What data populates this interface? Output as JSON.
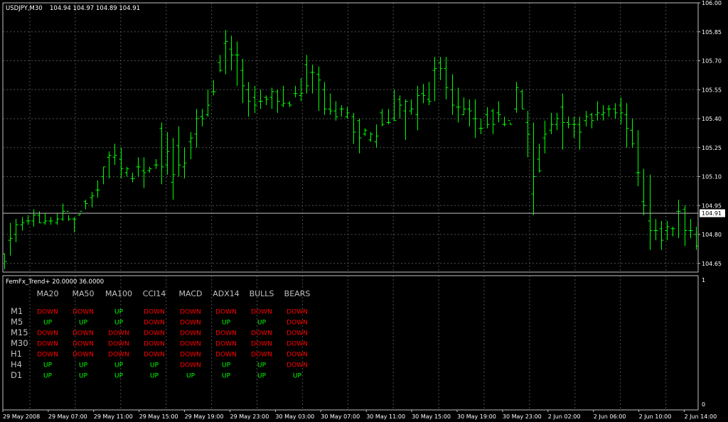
{
  "colors": {
    "background": "#000000",
    "grid": "#4a5050",
    "frame": "#c0c0c0",
    "bar": "#00ff00",
    "text": "#ffffff",
    "label_text": "#c0c0c0",
    "price_tag_bg": "#ffffff",
    "price_tag_text": "#000000",
    "up": "#00ff00",
    "down": "#ff0000"
  },
  "price_window": {
    "symbol": "USDJPY,M30",
    "ohlc": "104.94 104.97 104.89 104.91",
    "current_price_label": "104.91"
  },
  "indicator_window": {
    "name": "FemFx_Trend+ 20.0000 36.0000",
    "scale_top": "1",
    "scale_bottom": "0",
    "columns": [
      "MA20",
      "MA50",
      "MA100",
      "CCI14",
      "MACD",
      "ADX14",
      "BULLS",
      "BEARS"
    ],
    "rows": [
      {
        "timeframe": "M1",
        "signals": [
          "DOWN",
          "DOWN",
          "UP",
          "DOWN",
          "DOWN",
          "DOWN",
          "DOWN",
          "DOWN"
        ]
      },
      {
        "timeframe": "M5",
        "signals": [
          "UP",
          "UP",
          "UP",
          "DOWN",
          "DOWN",
          "UP",
          "UP",
          "DOWN"
        ]
      },
      {
        "timeframe": "M15",
        "signals": [
          "DOWN",
          "DOWN",
          "DOWN",
          "DOWN",
          "DOWN",
          "DOWN",
          "DOWN",
          "DOWN"
        ]
      },
      {
        "timeframe": "M30",
        "signals": [
          "DOWN",
          "DOWN",
          "DOWN",
          "DOWN",
          "DOWN",
          "DOWN",
          "DOWN",
          "DOWN"
        ]
      },
      {
        "timeframe": "H1",
        "signals": [
          "DOWN",
          "DOWN",
          "DOWN",
          "DOWN",
          "DOWN",
          "DOWN",
          "DOWN",
          "DOWN"
        ]
      },
      {
        "timeframe": "H4",
        "signals": [
          "UP",
          "UP",
          "UP",
          "UP",
          "DOWN",
          "UP",
          "UP",
          "DOWN"
        ]
      },
      {
        "timeframe": "D1",
        "signals": [
          "UP",
          "UP",
          "UP",
          "UP",
          "UP",
          "UP",
          "UP",
          "UP"
        ]
      }
    ]
  },
  "chart_data": {
    "type": "ohlc-bar",
    "title": "USDJPY,M30",
    "ylim": [
      104.6,
      106.0
    ],
    "y_ticks": [
      "106.00",
      "105.85",
      "105.70",
      "105.55",
      "105.40",
      "105.25",
      "105.10",
      "104.95",
      "104.80",
      "104.65"
    ],
    "x_ticks": [
      "29 May 2008",
      "29 May 07:00",
      "29 May 11:00",
      "29 May 15:00",
      "29 May 19:00",
      "29 May 23:00",
      "30 May 03:00",
      "30 May 07:00",
      "30 May 11:00",
      "30 May 15:00",
      "30 May 19:00",
      "30 May 23:00",
      "2 Jun 02:00",
      "2 Jun 06:00",
      "2 Jun 10:00",
      "2 Jun 14:00"
    ],
    "current_price": 104.91,
    "bars_high": [
      104.7,
      104.86,
      104.88,
      104.89,
      104.9,
      104.93,
      104.92,
      104.91,
      104.89,
      104.91,
      104.96,
      104.87,
      104.89,
      104.91,
      104.98,
      105.02,
      105.08,
      105.15,
      105.23,
      105.27,
      105.25,
      105.15,
      105.12,
      105.2,
      105.2,
      105.15,
      105.19,
      105.38,
      105.33,
      105.3,
      105.36,
      105.25,
      105.33,
      105.45,
      105.45,
      105.55,
      105.6,
      105.73,
      105.86,
      105.83,
      105.8,
      105.71,
      105.59,
      105.57,
      105.55,
      105.52,
      105.56,
      105.55,
      105.57,
      105.49,
      105.57,
      105.61,
      105.73,
      105.68,
      105.67,
      105.59,
      105.53,
      105.49,
      105.47,
      105.46,
      105.43,
      105.4,
      105.35,
      105.33,
      105.37,
      105.45,
      105.45,
      105.55,
      105.52,
      105.5,
      105.5,
      105.57,
      105.58,
      105.59,
      105.72,
      105.72,
      105.72,
      105.63,
      105.56,
      105.51,
      105.5,
      105.5,
      105.4,
      105.46,
      105.45,
      105.49,
      105.41,
      105.38,
      105.59,
      105.55,
      105.44,
      105.38,
      105.27,
      105.39,
      105.43,
      105.43,
      105.53,
      105.41,
      105.41,
      105.41,
      105.44,
      105.43,
      105.49,
      105.47,
      105.47,
      105.48,
      105.51,
      105.48,
      105.4,
      105.34,
      105.14,
      105.11,
      104.88,
      104.87,
      104.87,
      104.84,
      104.98,
      104.95,
      104.88,
      104.84
    ],
    "bars_low": [
      104.62,
      104.69,
      104.76,
      104.82,
      104.85,
      104.84,
      104.86,
      104.85,
      104.85,
      104.85,
      104.87,
      104.9,
      104.81,
      104.9,
      104.93,
      104.94,
      104.99,
      105.06,
      105.09,
      105.16,
      105.09,
      105.1,
      105.07,
      105.1,
      105.04,
      105.12,
      105.14,
      105.06,
      105.11,
      104.98,
      105.1,
      105.09,
      105.19,
      105.25,
      105.36,
      105.41,
      105.52,
      105.64,
      105.63,
      105.65,
      105.57,
      105.48,
      105.41,
      105.43,
      105.45,
      105.47,
      105.45,
      105.43,
      105.46,
      105.46,
      105.51,
      105.49,
      105.53,
      105.53,
      105.44,
      105.42,
      105.42,
      105.39,
      105.41,
      105.4,
      105.27,
      105.22,
      105.31,
      105.28,
      105.25,
      105.36,
      105.37,
      105.39,
      105.4,
      105.29,
      105.42,
      105.34,
      105.48,
      105.47,
      105.49,
      105.6,
      105.5,
      105.42,
      105.38,
      105.42,
      105.36,
      105.3,
      105.32,
      105.35,
      105.32,
      105.38,
      105.36,
      105.37,
      105.43,
      105.45,
      105.2,
      104.9,
      105.12,
      105.22,
      105.32,
      105.34,
      105.24,
      105.35,
      105.3,
      105.24,
      105.36,
      105.35,
      105.39,
      105.39,
      105.41,
      105.4,
      105.37,
      105.25,
      105.25,
      105.05,
      104.9,
      104.72,
      104.77,
      104.72,
      104.77,
      104.79,
      104.78,
      104.74,
      104.78,
      104.72
    ],
    "bars_open": [
      104.7,
      104.77,
      104.8,
      104.85,
      104.87,
      104.87,
      104.9,
      104.86,
      104.87,
      104.86,
      104.88,
      104.92,
      104.88,
      104.9,
      104.97,
      104.99,
      105.03,
      105.1,
      105.2,
      105.2,
      105.19,
      105.12,
      105.09,
      105.15,
      105.13,
      105.13,
      105.16,
      105.35,
      105.16,
      105.07,
      105.26,
      105.15,
      105.28,
      105.32,
      105.41,
      105.42,
      105.54,
      105.69,
      105.79,
      105.76,
      105.73,
      105.65,
      105.55,
      105.51,
      105.49,
      105.51,
      105.51,
      105.54,
      105.47,
      105.48,
      105.53,
      105.52,
      105.68,
      105.64,
      105.63,
      105.55,
      105.45,
      105.44,
      105.45,
      105.41,
      105.41,
      105.39,
      105.32,
      105.29,
      105.28,
      105.43,
      105.38,
      105.4,
      105.5,
      105.44,
      105.44,
      105.42,
      105.53,
      105.5,
      105.65,
      105.69,
      105.66,
      105.55,
      105.46,
      105.42,
      105.45,
      105.4,
      105.35,
      105.42,
      105.44,
      105.43,
      105.37,
      105.39,
      105.45,
      105.54,
      105.38,
      105.01,
      105.19,
      105.3,
      105.34,
      105.37,
      105.46,
      105.38,
      105.37,
      105.37,
      105.39,
      105.42,
      105.42,
      105.42,
      105.45,
      105.45,
      105.47,
      105.42,
      105.34,
      105.12,
      104.97,
      104.87,
      104.82,
      104.83,
      104.82,
      104.83,
      104.92,
      104.93,
      104.82,
      104.8
    ],
    "bars_close": [
      104.66,
      104.78,
      104.85,
      104.86,
      104.87,
      104.9,
      104.86,
      104.87,
      104.87,
      104.88,
      104.92,
      104.88,
      104.88,
      104.92,
      104.96,
      105.0,
      105.03,
      105.15,
      105.21,
      105.21,
      105.14,
      105.14,
      105.09,
      105.15,
      105.12,
      105.14,
      105.16,
      105.15,
      105.23,
      105.11,
      105.16,
      105.17,
      105.3,
      105.4,
      105.4,
      105.47,
      105.54,
      105.65,
      105.8,
      105.73,
      105.73,
      105.57,
      105.49,
      105.47,
      105.49,
      105.5,
      105.54,
      105.49,
      105.48,
      105.47,
      105.53,
      105.53,
      105.57,
      105.64,
      105.6,
      105.45,
      105.44,
      105.41,
      105.45,
      105.43,
      105.33,
      105.3,
      105.34,
      105.32,
      105.31,
      105.37,
      105.38,
      105.39,
      105.47,
      105.49,
      105.45,
      105.52,
      105.52,
      105.49,
      105.66,
      105.66,
      105.56,
      105.47,
      105.46,
      105.45,
      105.44,
      105.4,
      105.35,
      105.37,
      105.37,
      105.42,
      105.37,
      105.37,
      105.56,
      105.45,
      105.32,
      105.1,
      105.13,
      105.32,
      105.37,
      105.4,
      105.38,
      105.37,
      105.37,
      105.33,
      105.41,
      105.39,
      105.43,
      105.43,
      105.45,
      105.43,
      105.43,
      105.35,
      105.27,
      105.12,
      104.95,
      104.82,
      104.82,
      104.77,
      104.84,
      104.83,
      104.92,
      104.82,
      104.82,
      104.74
    ]
  }
}
